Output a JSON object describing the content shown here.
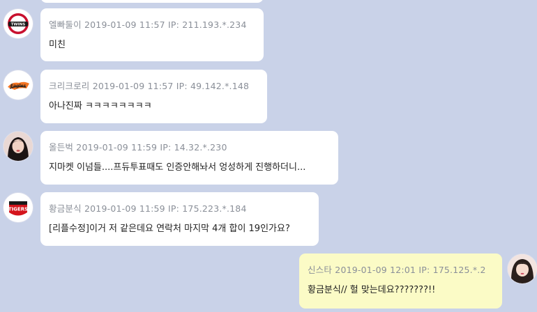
{
  "messages": [
    {
      "user": "엘빠둘이",
      "date": "2019-01-09 11:57",
      "ip_label": "IP:",
      "ip": "211.193.*.234",
      "text": "미친",
      "avatar_icon": "twins-logo-icon"
    },
    {
      "user": "크리크로리",
      "date": "2019-01-09 11:57",
      "ip_label": "IP:",
      "ip": "49.142.*.148",
      "text": "아나진짜 ㅋㅋㅋㅋㅋㅋㅋㅋ",
      "avatar_icon": "eagles-logo-icon"
    },
    {
      "user": "올든벅",
      "date": "2019-01-09 11:59",
      "ip_label": "IP:",
      "ip": "14.32.*.230",
      "text": "지마켓 이넘들....프듀투표때도 인증안해놔서 엉성하게 진행하더니...",
      "avatar_icon": "profile-photo-icon"
    },
    {
      "user": "황금분식",
      "date": "2019-01-09 11:59",
      "ip_label": "IP:",
      "ip": "175.223.*.184",
      "text": "[리플수정]이거 저 같은데요 연락처 마지막 4개 합이 19인가요?",
      "avatar_icon": "tigers-logo-icon"
    },
    {
      "user": "신스타",
      "date": "2019-01-09 12:01",
      "ip_label": "IP:",
      "ip": "175.125.*.2",
      "text": "황금분식// 헐 맞는데요???????!!",
      "avatar_icon": "profile-photo-icon"
    }
  ],
  "colors": {
    "background": "#c9d2e8",
    "bubble": "#ffffff",
    "my_bubble": "#fbfbc6",
    "meta_text": "#8a8f98"
  }
}
